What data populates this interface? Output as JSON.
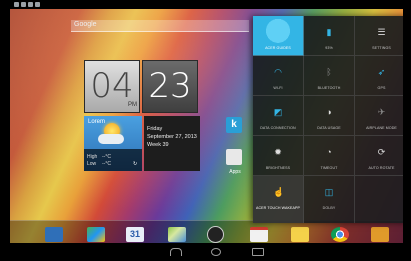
{
  "search": {
    "label": "Google"
  },
  "clock": {
    "hour": "04",
    "minute": "23",
    "ampm": "PM"
  },
  "weather": {
    "city": "Lorem",
    "high_label": "High",
    "high_value": "--°C",
    "low_label": "Low",
    "low_value": "--°C"
  },
  "date": {
    "weekday": "Friday",
    "full_date": "September 27, 2013",
    "week": "Week 39"
  },
  "apps": {
    "kindle_letter": "k",
    "grid_label": "Apps"
  },
  "dock": {
    "calendar_day": "31"
  },
  "quick_settings": {
    "tiles": [
      {
        "label": "ACER GUIDES",
        "icon": "acer-guide-icon",
        "glyph": ""
      },
      {
        "label": "93%",
        "icon": "battery-icon",
        "glyph": "▮"
      },
      {
        "label": "SETTINGS",
        "icon": "settings-sliders-icon",
        "glyph": "☰"
      },
      {
        "label": "WI-FI",
        "icon": "wifi-icon",
        "glyph": "◠"
      },
      {
        "label": "BLUETOOTH",
        "icon": "bluetooth-icon",
        "glyph": "ᛒ"
      },
      {
        "label": "GPS",
        "icon": "gps-icon",
        "glyph": "➶"
      },
      {
        "label": "DATA CONNECTION",
        "icon": "data-connection-icon",
        "glyph": "◩"
      },
      {
        "label": "DATA USAGE",
        "icon": "data-usage-icon",
        "glyph": "◑"
      },
      {
        "label": "AIRPLANE MODE",
        "icon": "airplane-icon",
        "glyph": "✈"
      },
      {
        "label": "BRIGHTNESS",
        "icon": "brightness-icon",
        "glyph": "✹"
      },
      {
        "label": "TIMEOUT",
        "icon": "timeout-icon",
        "glyph": "◔"
      },
      {
        "label": "AUTO ROTATE",
        "icon": "auto-rotate-icon",
        "glyph": "⟳"
      },
      {
        "label": "ACER TOUCH WAKEAPP",
        "icon": "touch-hand-icon",
        "glyph": "☝"
      },
      {
        "label": "DOLBY",
        "icon": "dolby-icon",
        "glyph": "◫"
      }
    ]
  },
  "colors": {
    "accent": "#33b5e5",
    "panel": "#191c1e"
  }
}
